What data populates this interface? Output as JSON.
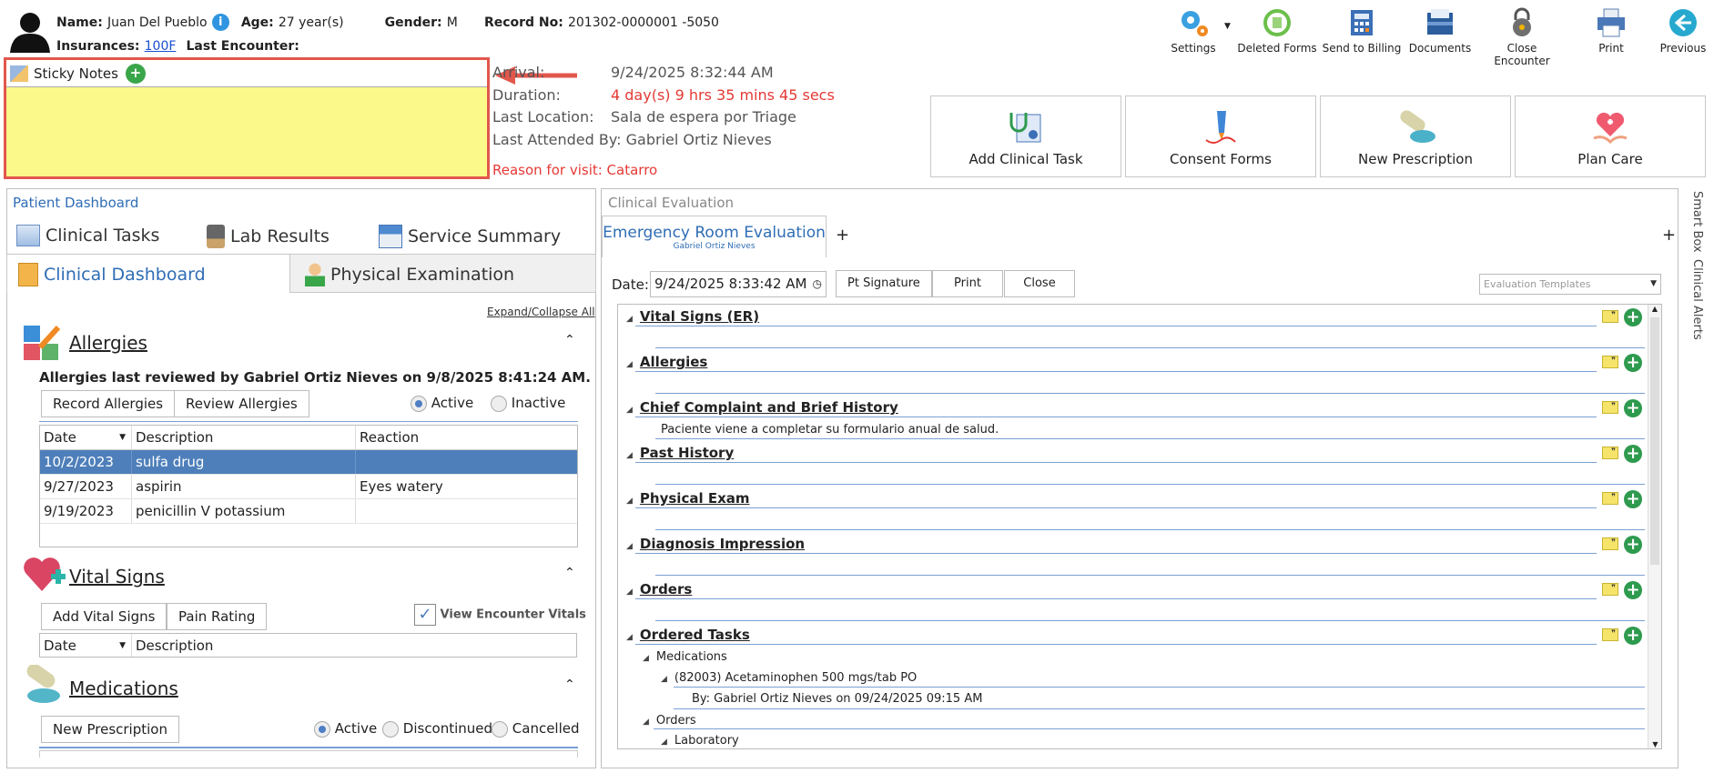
{
  "patient": {
    "name_label": "Name:",
    "name": "Juan Del Pueblo",
    "age_label": "Age:",
    "age": "27 year(s)",
    "gender_label": "Gender:",
    "gender": "M",
    "record_label": "Record No:",
    "record": "201302-0000001 -5050",
    "insurances_label": "Insurances:",
    "insurance": "100F",
    "last_encounter_label": "Last Encounter:"
  },
  "toolbar": {
    "settings": "Settings",
    "deleted_forms": "Deleted Forms",
    "send_billing": "Send to Billing",
    "documents": "Documents",
    "close_encounter": "Close Encounter",
    "print": "Print",
    "previous": "Previous"
  },
  "sticky": {
    "title": "Sticky Notes"
  },
  "visit": {
    "arrival_label": "Arrival:",
    "arrival": "9/24/2025 8:32:44 AM",
    "duration_label": "Duration:",
    "duration": "4 day(s) 9 hrs 35 mins 45 secs",
    "location_label": "Last Location:",
    "location": "Sala de espera por Triage",
    "attended_label": "Last Attended By:",
    "attended": "Gabriel Ortiz Nieves",
    "reason": "Reason for visit: Catarro"
  },
  "actions": {
    "add_task": "Add Clinical Task",
    "consent": "Consent Forms",
    "prescription": "New Prescription",
    "plan_care": "Plan Care"
  },
  "dashboard": {
    "title": "Patient Dashboard",
    "tabs": [
      "Clinical Tasks",
      "Lab Results",
      "Service Summary",
      "Clinical Dashboard",
      "Physical Examination"
    ],
    "expand": "Expand/Collapse All",
    "allergies": {
      "title": "Allergies",
      "reviewed": "Allergies last reviewed by Gabriel Ortiz Nieves on 9/8/2025 8:41:24 AM.",
      "record_btn": "Record Allergies",
      "review_btn": "Review Allergies",
      "active": "Active",
      "inactive": "Inactive",
      "cols": [
        "Date",
        "Description",
        "Reaction"
      ],
      "rows": [
        [
          "10/2/2023",
          "sulfa drug",
          ""
        ],
        [
          "9/27/2023",
          "aspirin",
          "Eyes watery"
        ],
        [
          "9/19/2023",
          "penicillin V potassium",
          ""
        ]
      ]
    },
    "vitals": {
      "title": "Vital Signs",
      "add_btn": "Add Vital Signs",
      "pain_btn": "Pain Rating",
      "view_enc": "View Encounter Vitals",
      "cols": [
        "Date",
        "Description"
      ]
    },
    "meds": {
      "title": "Medications",
      "new_btn": "New Prescription",
      "active": "Active",
      "discontinued": "Discontinued",
      "cancelled": "Cancelled"
    }
  },
  "evaluation": {
    "header": "Clinical Evaluation",
    "tab": "Emergency Room Evaluation",
    "tab_sub": "Gabriel Ortiz Nieves",
    "date_label": "Date:",
    "date": "9/24/2025 8:33:42 AM",
    "pt_sig": "Pt Signature",
    "print": "Print",
    "close": "Close",
    "templates": "Evaluation Templates",
    "sections": [
      "Vital Signs (ER)",
      "Allergies",
      "Chief Complaint and Brief History",
      "Past History",
      "Physical Exam",
      "Diagnosis Impression",
      "Orders",
      "Ordered Tasks"
    ],
    "chief_text": "Paciente viene a completar su formulario anual de salud.",
    "tasks": {
      "medications": "Medications",
      "med_item": "(82003) Acetaminophen 500 mgs/tab PO",
      "med_by": "By: Gabriel Ortiz Nieves on 09/24/2025 09:15 AM",
      "orders": "Orders",
      "laboratory": "Laboratory"
    }
  },
  "side": {
    "smart_box": "Smart Box",
    "clinical_alerts": "Clinical Alerts"
  }
}
